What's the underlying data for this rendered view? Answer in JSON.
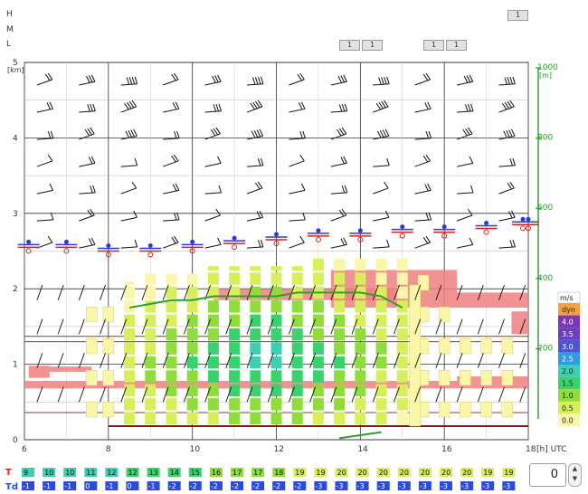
{
  "level_labels": [
    "H",
    "M",
    "L"
  ],
  "level_buttons": {
    "H": [
      "1"
    ],
    "L": [
      "1",
      "1",
      "1",
      "1"
    ]
  },
  "chart_data": {
    "type": "meteogram",
    "x_ticks": [
      "6",
      "8",
      "10",
      "12",
      "14",
      "16",
      "18"
    ],
    "x_unit": "[h] UTC",
    "y_left_ticks": [
      "0",
      "1",
      "2",
      "3",
      "4",
      "5"
    ],
    "y_left_unit": "[km]",
    "xlim": [
      6,
      18
    ],
    "ylim": [
      0,
      5
    ],
    "y_right_ticks": [
      "200",
      "400",
      "600",
      "800",
      "1000"
    ],
    "y_right_unit": "[m]",
    "y_right_values": [
      200,
      400,
      600,
      800,
      1000
    ],
    "thermal_tops_km": [
      2.1,
      2.2,
      2.2,
      2.2,
      2.3,
      2.3,
      2.3,
      2.3,
      2.3,
      2.4,
      2.4,
      2.4,
      2.4,
      2.4
    ],
    "thermal_top_hours": [
      8.5,
      9.0,
      9.5,
      10.0,
      10.5,
      11.0,
      11.5,
      12.0,
      12.5,
      13.0,
      13.5,
      14.0,
      14.5,
      15.0
    ],
    "bl_line_km": [
      1.75,
      1.8,
      1.85,
      1.85,
      1.9,
      1.9,
      1.9,
      1.9,
      1.95,
      1.95,
      1.95,
      1.95,
      1.9,
      1.75
    ],
    "bl_line_hours": [
      8.5,
      9.0,
      9.5,
      10.0,
      10.5,
      11.0,
      11.5,
      12.0,
      12.5,
      13.0,
      13.5,
      14.0,
      14.5,
      15.0
    ],
    "cloud_markers_km": [
      2.55,
      2.55,
      2.5,
      2.5,
      2.55,
      2.6,
      2.65,
      2.7,
      2.7,
      2.75,
      2.75,
      2.8,
      2.85,
      2.85
    ],
    "marker_hours": [
      6.1,
      7.0,
      8.0,
      9.0,
      10.0,
      11.0,
      12.0,
      13.0,
      14.0,
      15.0,
      16.0,
      17.0,
      18.0,
      18.0
    ],
    "legend": {
      "unit": "m/s",
      "entries": [
        {
          "label": "dyn",
          "color": "#f0a040"
        },
        {
          "label": "4.0",
          "color": "#7f35b8"
        },
        {
          "label": "3.5",
          "color": "#6a3fc0"
        },
        {
          "label": "3.0",
          "color": "#4b55cf"
        },
        {
          "label": "2.5",
          "color": "#2f9be0"
        },
        {
          "label": "2.0",
          "color": "#3dd0b0"
        },
        {
          "label": "1.5",
          "color": "#39d36e"
        },
        {
          "label": "1.0",
          "color": "#8edd3a"
        },
        {
          "label": "0.5",
          "color": "#d6ef5a"
        },
        {
          "label": "0.0",
          "color": "#fbf7a8"
        }
      ]
    },
    "T": [
      "9",
      "10",
      "10",
      "11",
      "12",
      "12",
      "13",
      "14",
      "15",
      "16",
      "17",
      "17",
      "18",
      "19",
      "19",
      "20",
      "20",
      "20",
      "20",
      "20",
      "20",
      "20",
      "19",
      "19"
    ],
    "Td": [
      "-1",
      "-1",
      "-1",
      "0",
      "-1",
      "0",
      "-1",
      "-2",
      "-2",
      "-2",
      "-2",
      "-2",
      "-2",
      "-2",
      "-3",
      "-3",
      "-3",
      "-3",
      "-3",
      "-3",
      "-3",
      "-3",
      "-3",
      "-3"
    ],
    "row_labels": {
      "T": "T",
      "Td": "Td"
    },
    "colors": {
      "grid": "#333333",
      "right_axis": "#2a9a2a",
      "inversion": "#f08080",
      "bl_line": "#2e9e2e",
      "t_label": "#d62020",
      "td_label": "#2b4bd8"
    }
  },
  "stepper": {
    "value": "0"
  }
}
